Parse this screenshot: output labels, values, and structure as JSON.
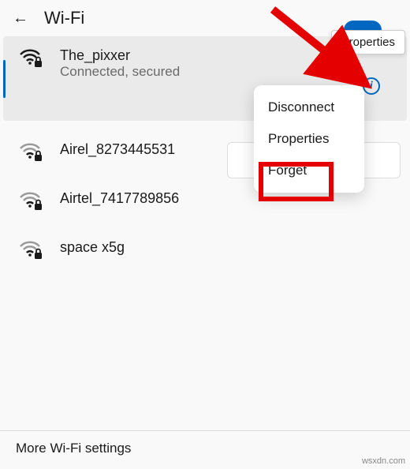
{
  "header": {
    "title": "Wi-Fi",
    "tooltip": "Properties"
  },
  "connected": {
    "name": "The_pixxer",
    "status": "Connected, secured"
  },
  "networks": [
    {
      "name": "Airel_8273445531"
    },
    {
      "name": "Airtel_7417789856"
    },
    {
      "name": "space x5g"
    }
  ],
  "menu": {
    "disconnect": "Disconnect",
    "properties": "Properties",
    "forget": "Forget"
  },
  "footer": "More Wi-Fi settings",
  "watermark": "wsxdn.com"
}
